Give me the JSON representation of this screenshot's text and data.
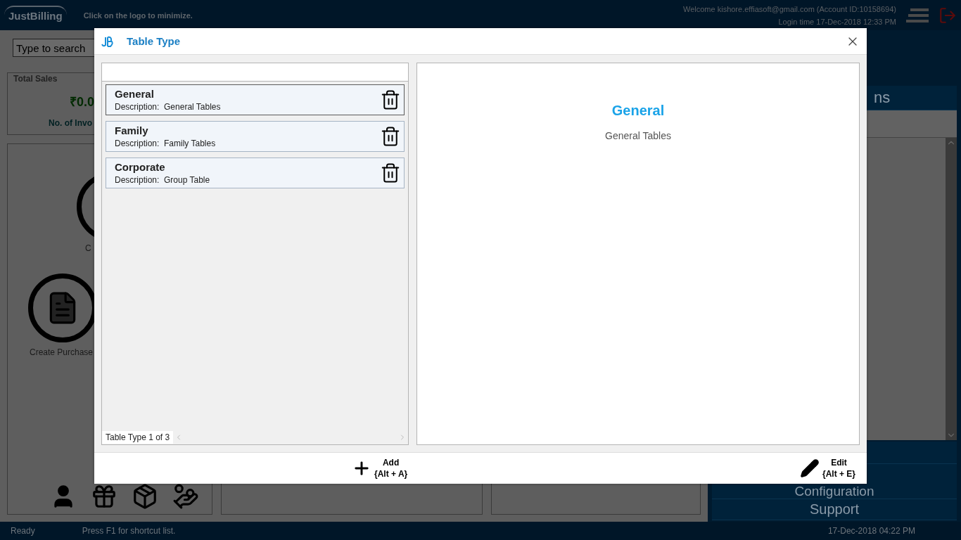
{
  "app": {
    "logo": "JustBilling",
    "hint": "Click on the logo to minimize.",
    "welcome": "Welcome kishore.effiasoft@gmail.com (Account ID:10158694)",
    "login_time": "Login time  17-Dec-2018 12:33 PM"
  },
  "search": {
    "placeholder": "Type to search"
  },
  "sales_card": {
    "title": "Total Sales",
    "amount": "₹0.0",
    "invoices_label": "No. of Invo"
  },
  "shortcuts": [
    {
      "label": "C"
    },
    {
      "label": "Create Purchase"
    }
  ],
  "side_menu": [
    {
      "label": "ns"
    },
    {
      "label": "Configuration"
    },
    {
      "label": "Support"
    }
  ],
  "status_bar": {
    "state": "Ready",
    "hint": "Press F1 for shortcut list.",
    "clock": "17-Dec-2018 04:22 PM"
  },
  "dialog": {
    "title": "Table Type",
    "items": [
      {
        "name": "General",
        "description_label": "Description:",
        "description": "General Tables",
        "selected": true
      },
      {
        "name": "Family",
        "description_label": "Description:",
        "description": "Family Tables",
        "selected": false
      },
      {
        "name": "Corporate",
        "description_label": "Description:",
        "description": "Group Table",
        "selected": false
      }
    ],
    "counter": "Table Type 1 of 3",
    "detail": {
      "name": "General",
      "description": "General Tables"
    },
    "actions": [
      {
        "kind": "add",
        "label": "Add",
        "shortcut": "{Alt + A}"
      },
      {
        "kind": "edit",
        "label": "Edit",
        "shortcut": "{Alt + E}"
      }
    ]
  }
}
